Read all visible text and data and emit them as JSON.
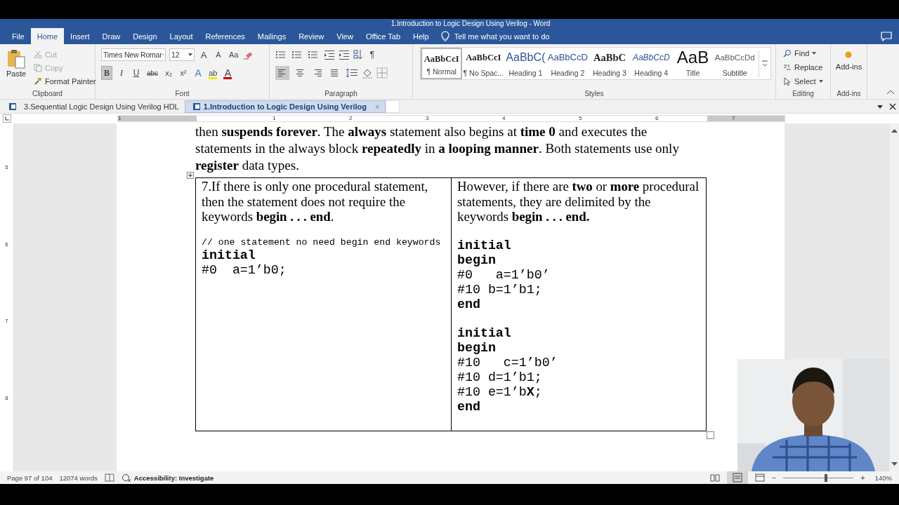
{
  "window": {
    "title": "1.Introduction to Logic Design Using Verilog  -  Word"
  },
  "menu": [
    {
      "label": "File",
      "selected": false
    },
    {
      "label": "Home",
      "selected": true
    },
    {
      "label": "Insert",
      "selected": false
    },
    {
      "label": "Draw",
      "selected": false
    },
    {
      "label": "Design",
      "selected": false
    },
    {
      "label": "Layout",
      "selected": false
    },
    {
      "label": "References",
      "selected": false
    },
    {
      "label": "Mailings",
      "selected": false
    },
    {
      "label": "Review",
      "selected": false
    },
    {
      "label": "View",
      "selected": false
    },
    {
      "label": "Office Tab",
      "selected": false
    },
    {
      "label": "Help",
      "selected": false
    }
  ],
  "tell_me": "Tell me what you want to do",
  "clipboard": {
    "paste": "Paste",
    "cut": "Cut",
    "copy": "Copy",
    "format_painter": "Format Painter",
    "label": "Clipboard"
  },
  "font": {
    "name": "Times New Romar",
    "size": "12",
    "label": "Font",
    "row1": [
      {
        "label": "A",
        "kind": "grow"
      },
      {
        "label": "A",
        "kind": "shrink"
      },
      {
        "label": "Aa",
        "kind": "case"
      }
    ],
    "row2": [
      {
        "label": "B",
        "kind": "bold",
        "on": true
      },
      {
        "label": "I",
        "kind": "italic",
        "on": false
      },
      {
        "label": "U",
        "kind": "underline",
        "on": false
      },
      {
        "label": "abc",
        "kind": "strike",
        "on": false
      },
      {
        "label": "x₂",
        "kind": "sub",
        "on": false
      },
      {
        "label": "x²",
        "kind": "sup",
        "on": false
      },
      {
        "label": "A",
        "kind": "effects",
        "on": false
      },
      {
        "label": "ab",
        "kind": "highlight",
        "on": false,
        "color": "#f5e900"
      },
      {
        "label": "A",
        "kind": "fontcolor",
        "on": false,
        "color": "#c00000"
      }
    ]
  },
  "paragraph": {
    "label": "Paragraph",
    "marks": "¶",
    "alignments": [
      {
        "kind": "left",
        "selected": true
      },
      {
        "kind": "center",
        "selected": false
      },
      {
        "kind": "right",
        "selected": false
      },
      {
        "kind": "justify",
        "selected": false
      }
    ]
  },
  "styles": {
    "label": "Styles",
    "items": [
      {
        "preview": "AaBbCcI",
        "name": "¶ Normal",
        "kind": "normal",
        "selected": true
      },
      {
        "preview": "AaBbCcI",
        "name": "¶ No Spac...",
        "kind": "nospacing",
        "selected": false
      },
      {
        "preview": "AaBbC(",
        "name": "Heading 1",
        "kind": "heading1",
        "selected": false
      },
      {
        "preview": "AaBbCcD",
        "name": "Heading 2",
        "kind": "heading2",
        "selected": false
      },
      {
        "preview": "AaBbC",
        "name": "Heading 3",
        "kind": "heading3",
        "selected": false
      },
      {
        "preview": "AaBbCcD",
        "name": "Heading 4",
        "kind": "heading4",
        "selected": false
      },
      {
        "preview": "AaB",
        "name": "Title",
        "kind": "title",
        "selected": false
      },
      {
        "preview": "AaBbCcDd",
        "name": "Subtitle",
        "kind": "subtitle",
        "selected": false
      }
    ]
  },
  "editing": {
    "label": "Editing",
    "find": "Find",
    "replace": "Replace",
    "select": "Select"
  },
  "addins": {
    "button": "Add-ins",
    "label": "Add-ins"
  },
  "doc_tabs": [
    {
      "label": "3.Sequential Logic Design Using Verilog HDL",
      "selected": false
    },
    {
      "label": "1.Introduction to Logic Design Using Verilog",
      "selected": true
    }
  ],
  "doc_tab_close": "×",
  "ruler": [
    "1",
    "1",
    "2",
    "3",
    "4",
    "5",
    "6",
    "7"
  ],
  "vruler": [
    "5",
    "6",
    "7",
    "8"
  ],
  "document": {
    "paragraph": "then **suspends forever**. The **always** statement also begins at **time 0** and executes the statements in the always block **repeatedly** in **a looping manner**. Both statements use only **register** data types.",
    "table": [
      {
        "text": "7.If there is only one procedural statement, then the statement does not require the keywords **begin . . . end**.",
        "comment": "// one statement no need begin end keywords",
        "blocks": [
          [
            {
              "text": "initial",
              "bold": true
            },
            {
              "text": "#0  a=1’b0;",
              "bold": false
            }
          ]
        ]
      },
      {
        "text": "However, if there are **two** or **more** procedural statements, they are delimited by the keywords **begin . . . end.**",
        "blocks": [
          [
            {
              "text": "initial",
              "bold": true
            },
            {
              "text": "begin",
              "bold": true
            },
            {
              "text": "#0   a=1’b0’",
              "bold": false
            },
            {
              "text": "#10 b=1’b1;",
              "bold": false
            },
            {
              "text": "end",
              "bold": true
            }
          ],
          [
            {
              "text": "initial",
              "bold": true
            },
            {
              "text": "begin",
              "bold": true
            },
            {
              "text": "#10   c=1’b0’",
              "bold": false
            },
            {
              "text": "#10 d=1’b1;",
              "bold": false
            },
            {
              "text": "#10 e=1’b**X**;",
              "bold": false
            },
            {
              "text": "end",
              "bold": true
            }
          ]
        ]
      }
    ]
  },
  "status_bar": {
    "page": "Page 97 of 104",
    "words": "12074 words",
    "accessibility": "Accessibility: Investigate",
    "zoom_minus": "−",
    "zoom_plus": "+",
    "zoom": {
      "level": 0.61
    },
    "zoom_percent": "140%"
  },
  "webcam": {
    "kind": "picture"
  }
}
